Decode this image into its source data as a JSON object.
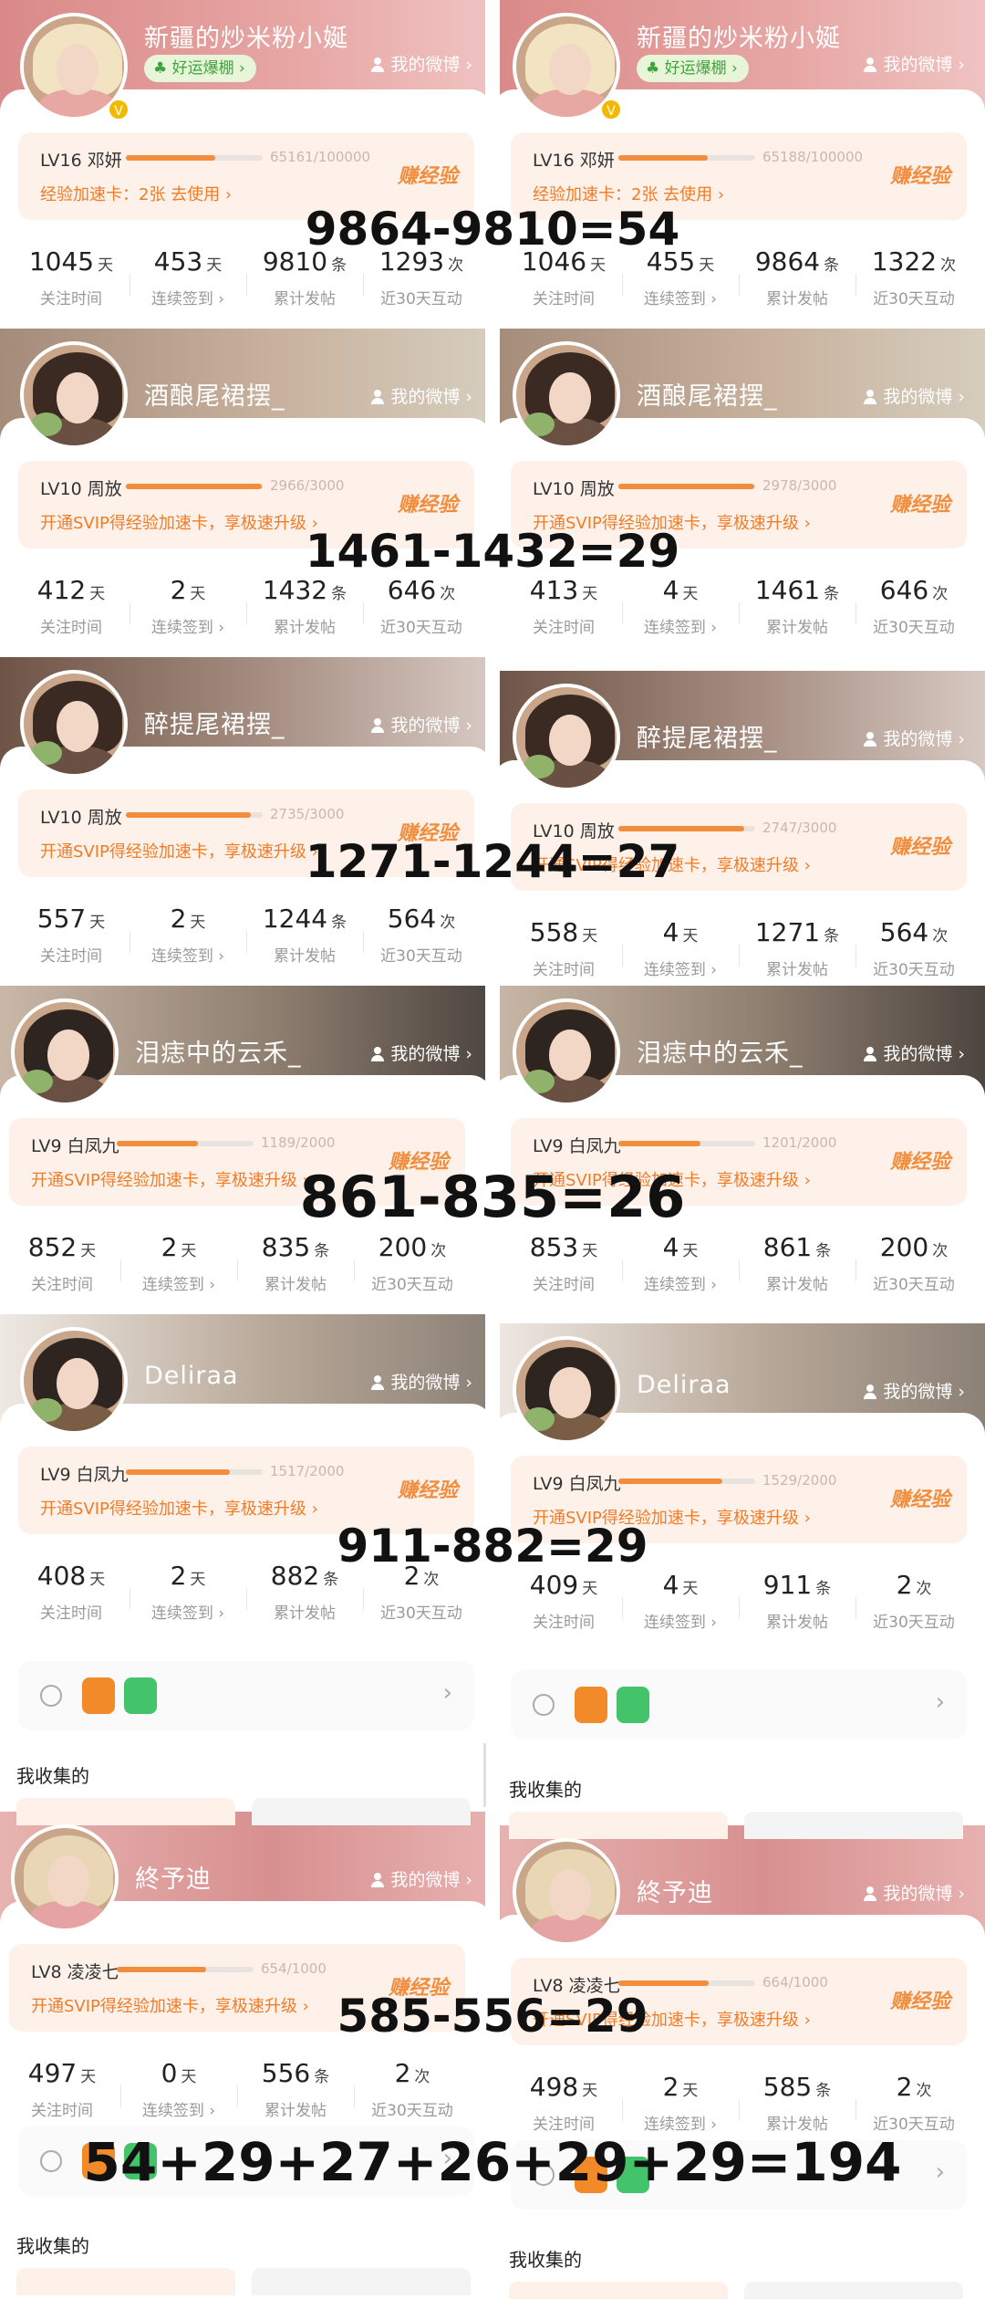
{
  "labels": {
    "my_weibo": "我的微博",
    "earn_exp": "赚经验",
    "lucky_badge": "好运爆棚",
    "collect_title": "我收集的",
    "stat_labels": [
      "关注时间",
      "连续签到",
      "累计发帖",
      "近30天互动"
    ],
    "stat_units": [
      "天",
      "天",
      "条",
      "次"
    ]
  },
  "colors": {
    "accent_orange": "#f28d3d",
    "promo_orange": "#f27c25",
    "card_panel": "#ffffff",
    "level_box_bg": "#fdf1ea"
  },
  "left_cards": [
    {
      "nickname": "新疆的炒米粉小娫",
      "lucky": true,
      "level": "LV16 邓妍",
      "progress_text": "65161/100000",
      "progress": 0.65,
      "promo": "经验加速卡：2张 去使用",
      "stats": [
        "1045",
        "453",
        "9810",
        "1293"
      ],
      "stat_arrows": [
        false,
        true,
        false,
        false
      ]
    },
    {
      "nickname": "酒酿尾裙摆_",
      "lucky": false,
      "level": "LV10 周放",
      "progress_text": "2966/3000",
      "progress": 0.99,
      "promo": "开通SVIP得经验加速卡，享极速升级",
      "stats": [
        "412",
        "2",
        "1432",
        "646"
      ],
      "stat_arrows": [
        false,
        true,
        false,
        false
      ]
    },
    {
      "nickname": "醉提尾裙摆_",
      "lucky": false,
      "level": "LV10 周放",
      "progress_text": "2735/3000",
      "progress": 0.91,
      "promo": "开通SVIP得经验加速卡，享极速升级",
      "stats": [
        "557",
        "2",
        "1244",
        "564"
      ],
      "stat_arrows": [
        false,
        true,
        false,
        false
      ]
    },
    {
      "nickname": "泪痣中的云禾_",
      "lucky": false,
      "level": "LV9 白凤九",
      "progress_text": "1189/2000",
      "progress": 0.59,
      "promo": "开通SVIP得经验加速卡，享极速升级",
      "stats": [
        "852",
        "2",
        "835",
        "200"
      ],
      "stat_arrows": [
        false,
        true,
        false,
        false
      ]
    },
    {
      "nickname": "Deliraa",
      "lucky": false,
      "level": "LV9 白凤九",
      "progress_text": "1517/2000",
      "progress": 0.76,
      "promo": "开通SVIP得经验加速卡，享极速升级",
      "stats": [
        "408",
        "2",
        "882",
        "2"
      ],
      "stat_arrows": [
        false,
        true,
        false,
        false
      ]
    },
    {
      "nickname": "終予迪",
      "lucky": false,
      "level": "LV8 凌凌七",
      "progress_text": "654/1000",
      "progress": 0.65,
      "promo": "开通SVIP得经验加速卡，享极速升级",
      "stats": [
        "497",
        "0",
        "556",
        "2"
      ],
      "stat_arrows": [
        false,
        true,
        false,
        false
      ]
    }
  ],
  "right_cards": [
    {
      "nickname": "新疆的炒米粉小娫",
      "lucky": true,
      "level": "LV16 邓妍",
      "progress_text": "65188/100000",
      "progress": 0.65,
      "promo": "经验加速卡：2张 去使用",
      "stats": [
        "1046",
        "455",
        "9864",
        "1322"
      ],
      "stat_arrows": [
        false,
        true,
        false,
        false
      ]
    },
    {
      "nickname": "酒酿尾裙摆_",
      "lucky": false,
      "level": "LV10 周放",
      "progress_text": "2978/3000",
      "progress": 0.99,
      "promo": "开通SVIP得经验加速卡，享极速升级",
      "stats": [
        "413",
        "4",
        "1461",
        "646"
      ],
      "stat_arrows": [
        false,
        true,
        false,
        false
      ]
    },
    {
      "nickname": "醉提尾裙摆_",
      "lucky": false,
      "level": "LV10 周放",
      "progress_text": "2747/3000",
      "progress": 0.92,
      "promo": "开通SVIP得经验加速卡，享极速升级",
      "stats": [
        "558",
        "4",
        "1271",
        "564"
      ],
      "stat_arrows": [
        false,
        true,
        false,
        false
      ]
    },
    {
      "nickname": "泪痣中的云禾_",
      "lucky": false,
      "level": "LV9 白凤九",
      "progress_text": "1201/2000",
      "progress": 0.6,
      "promo": "开通SVIP得经验加速卡，享极速升级",
      "stats": [
        "853",
        "4",
        "861",
        "200"
      ],
      "stat_arrows": [
        false,
        true,
        false,
        false
      ]
    },
    {
      "nickname": "Deliraa",
      "lucky": false,
      "level": "LV9 白凤九",
      "progress_text": "1529/2000",
      "progress": 0.76,
      "promo": "开通SVIP得经验加速卡，享极速升级",
      "stats": [
        "409",
        "4",
        "911",
        "2"
      ],
      "stat_arrows": [
        false,
        true,
        false,
        false
      ]
    },
    {
      "nickname": "終予迪",
      "lucky": false,
      "level": "LV8 凌凌七",
      "progress_text": "664/1000",
      "progress": 0.66,
      "promo": "开通SVIP得经验加速卡，享极速升级",
      "stats": [
        "498",
        "2",
        "585",
        "2"
      ],
      "stat_arrows": [
        false,
        true,
        false,
        false
      ]
    }
  ],
  "equations": [
    "9864-9810=54",
    "1461-1432=29",
    "1271-1244=27",
    "861-835=26",
    "911-882=29",
    "585-556=29",
    "54+29+27+26+29+29=194"
  ]
}
